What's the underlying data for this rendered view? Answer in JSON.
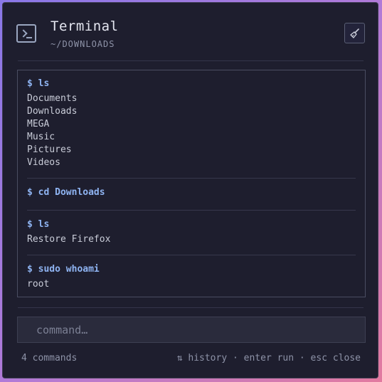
{
  "header": {
    "title": "Terminal",
    "subtitle": "~/DOWNLOADS",
    "icon": "terminal-icon",
    "clear_icon": "broom-icon"
  },
  "output": [
    {
      "command": "$ ls",
      "lines": [
        "Documents",
        "Downloads",
        "MEGA",
        "Music",
        "Pictures",
        "Videos"
      ]
    },
    {
      "command": "$ cd Downloads",
      "lines": []
    },
    {
      "command": "$ ls",
      "lines": [
        "Restore Firefox"
      ]
    },
    {
      "command": "$ sudo whoami",
      "lines": [
        "root"
      ]
    }
  ],
  "input": {
    "placeholder": "command…",
    "value": ""
  },
  "footer": {
    "count": "4 commands",
    "hints": "⇅ history · enter run · esc close"
  },
  "colors": {
    "background": "#1e1e2e",
    "command": "#8fb4f2",
    "text": "#c9ccd8"
  }
}
